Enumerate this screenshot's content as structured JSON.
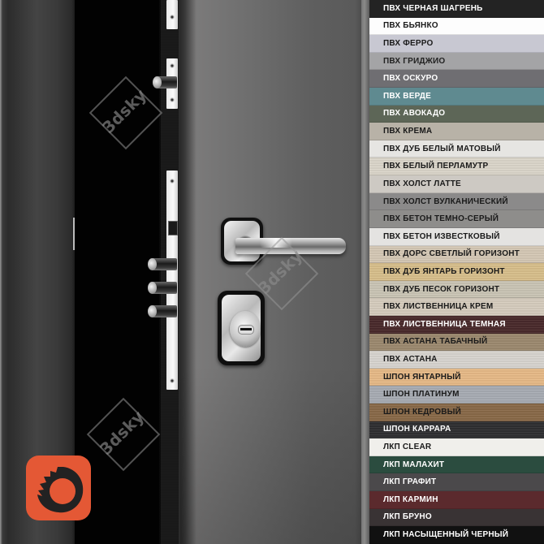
{
  "scene": {
    "subject": "steel entrance door with handle, cylinder lock and multipoint bolts",
    "watermark_text": "3dsky",
    "logo_icon": "corona-renderer-logo",
    "logo_color": "#e45835"
  },
  "swatches": [
    {
      "label": "ПВХ ЧЕРНАЯ ШАГРЕНЬ",
      "color": "#232323",
      "text_color": "#ffffff"
    },
    {
      "label": "ПВХ БЬЯНКО",
      "color": "#fdfdfd",
      "text_color": "#1a1a1a"
    },
    {
      "label": "ПВХ ФЕРРО",
      "color": "#c8c8d2",
      "text_color": "#1a1a1a"
    },
    {
      "label": "ПВХ ГРИДЖИО",
      "color": "#a4a4a6",
      "text_color": "#222222"
    },
    {
      "label": "ПВХ ОСКУРО",
      "color": "#6f6e72",
      "text_color": "#ffffff"
    },
    {
      "label": "ПВХ ВЕРДЕ",
      "color": "#5f8a90",
      "text_color": "#ffffff"
    },
    {
      "label": "ПВХ АВОКАДО",
      "color": "#5d6657",
      "text_color": "#ffffff"
    },
    {
      "label": "ПВХ КРЕМА",
      "color": "#b8b2a7",
      "text_color": "#1a1a1a"
    },
    {
      "label": "ПВХ ДУБ БЕЛЫЙ МАТОВЫЙ",
      "color": "#e6e5e2",
      "text_color": "#1a1a1a"
    },
    {
      "label": "ПВХ БЕЛЫЙ ПЕРЛАМУТР",
      "color": "#dcd7cb",
      "text_color": "#1a1a1a"
    },
    {
      "label": "ПВХ ХОЛСТ ЛАТТЕ",
      "color": "#cdc9c3",
      "text_color": "#1a1a1a"
    },
    {
      "label": "ПВХ ХОЛСТ ВУЛКАНИЧЕСКИЙ",
      "color": "#8b8a8a",
      "text_color": "#1a1a1a"
    },
    {
      "label": "ПВХ БЕТОН ТЕМНО-СЕРЫЙ",
      "color": "#8e8d8b",
      "text_color": "#1a1a1a"
    },
    {
      "label": "ПВХ БЕТОН ИЗВЕСТКОВЫЙ",
      "color": "#e4e3e1",
      "text_color": "#1a1a1a"
    },
    {
      "label": "ПВХ ДОРС СВЕТЛЫЙ ГОРИЗОНТ",
      "color": "#d6c9b6",
      "text_color": "#1a1a1a"
    },
    {
      "label": "ПВХ ДУБ ЯНТАРЬ ГОРИЗОНТ",
      "color": "#d9c08c",
      "text_color": "#1a1a1a"
    },
    {
      "label": "ПВХ ДУБ ПЕСОК ГОРИЗОНТ",
      "color": "#cbc6b6",
      "text_color": "#1a1a1a"
    },
    {
      "label": "ПВХ ЛИСТВЕННИЦА КРЕМ",
      "color": "#d7cdbf",
      "text_color": "#1a1a1a"
    },
    {
      "label": "ПВХ ЛИСТВЕННИЦА ТЕМНАЯ",
      "color": "#4a2a2c",
      "text_color": "#ffffff"
    },
    {
      "label": "ПВХ АСТАНА ТАБАЧНЫЙ",
      "color": "#9d8a70",
      "text_color": "#1a1a1a"
    },
    {
      "label": "ПВХ АСТАНА",
      "color": "#d9d6d1",
      "text_color": "#1a1a1a"
    },
    {
      "label": "ШПОН ЯНТАРНЫЙ",
      "color": "#e8bb88",
      "text_color": "#1a1a1a"
    },
    {
      "label": "ШПОН ПЛАТИНУМ",
      "color": "#a9adb4",
      "text_color": "#1a1a1a"
    },
    {
      "label": "ШПОН КЕДРОВЫЙ",
      "color": "#8a6a49",
      "text_color": "#1a1a1a"
    },
    {
      "label": "ШПОН КАРРАРА",
      "color": "#2f2f31",
      "text_color": "#ffffff"
    },
    {
      "label": "ЛКП CLEAR",
      "color": "#f0efeb",
      "text_color": "#1a1a1a"
    },
    {
      "label": "ЛКП МАЛАХИТ",
      "color": "#2b4c3f",
      "text_color": "#ffffff"
    },
    {
      "label": "ЛКП ГРАФИТ",
      "color": "#4b494b",
      "text_color": "#ffffff"
    },
    {
      "label": "ЛКП КАРМИН",
      "color": "#5b2a2d",
      "text_color": "#ffffff"
    },
    {
      "label": "ЛКП БРУНО",
      "color": "#393334",
      "text_color": "#ffffff"
    },
    {
      "label": "ЛКП НАСЫЩЕННЫЙ ЧЕРНЫЙ",
      "color": "#111111",
      "text_color": "#ffffff"
    }
  ]
}
